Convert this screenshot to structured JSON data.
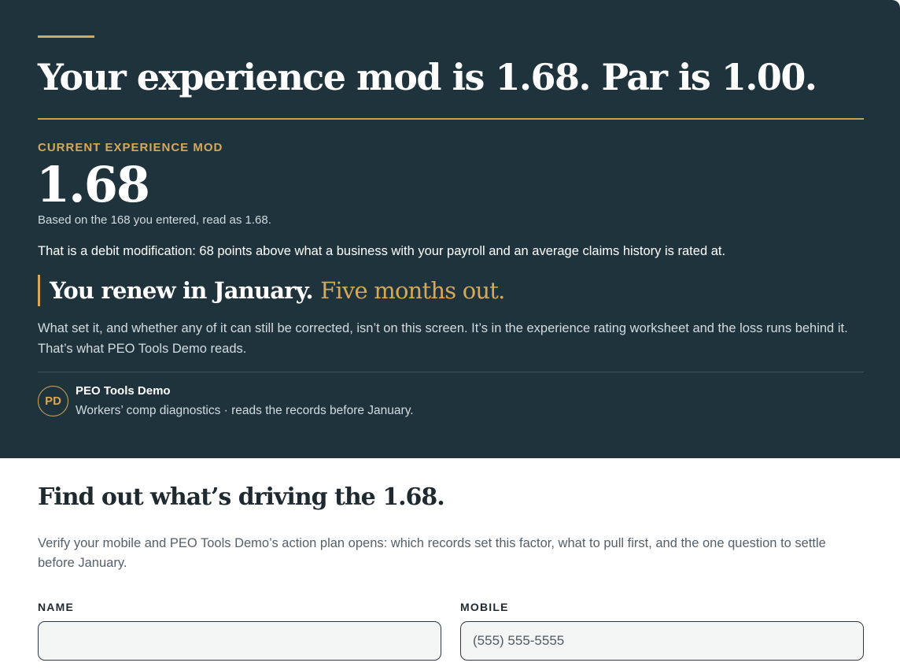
{
  "hero": {
    "headline": "Your experience mod is 1.68. Par is 1.00.",
    "mod_label": "CURRENT EXPERIENCE MOD",
    "mod_value": "1.68",
    "mod_note": "Based on the 168 you entered, read as 1.68.",
    "debit_text": "That is a debit modification: 68 points above what a business with your payroll and an average claims history is rated at.",
    "renew_lead": "You renew in January.",
    "renew_sub": "Five months out.",
    "explanation": "What set it, and whether any of it can still be corrected, isn’t on this screen. It’s in the experience rating worksheet and the loss runs behind it. That’s what PEO Tools Demo reads."
  },
  "brand": {
    "initials": "PD",
    "name": "PEO Tools Demo",
    "tagline": "Workers’ comp diagnostics · reads the records before January."
  },
  "form": {
    "title": "Find out what’s driving the 1.68.",
    "description": "Verify your mobile and PEO Tools Demo’s action plan opens: which records set this factor, what to pull first, and the one question to settle before January.",
    "name_label": "NAME",
    "name_value": "",
    "name_placeholder": "",
    "mobile_label": "MOBILE",
    "mobile_value": "",
    "mobile_placeholder": "(555) 555-5555"
  },
  "colors": {
    "hero_background": "#1f333d",
    "accent_gold": "#d6a85a",
    "page_background": "#ffffff",
    "input_background": "#f4f6f5"
  }
}
